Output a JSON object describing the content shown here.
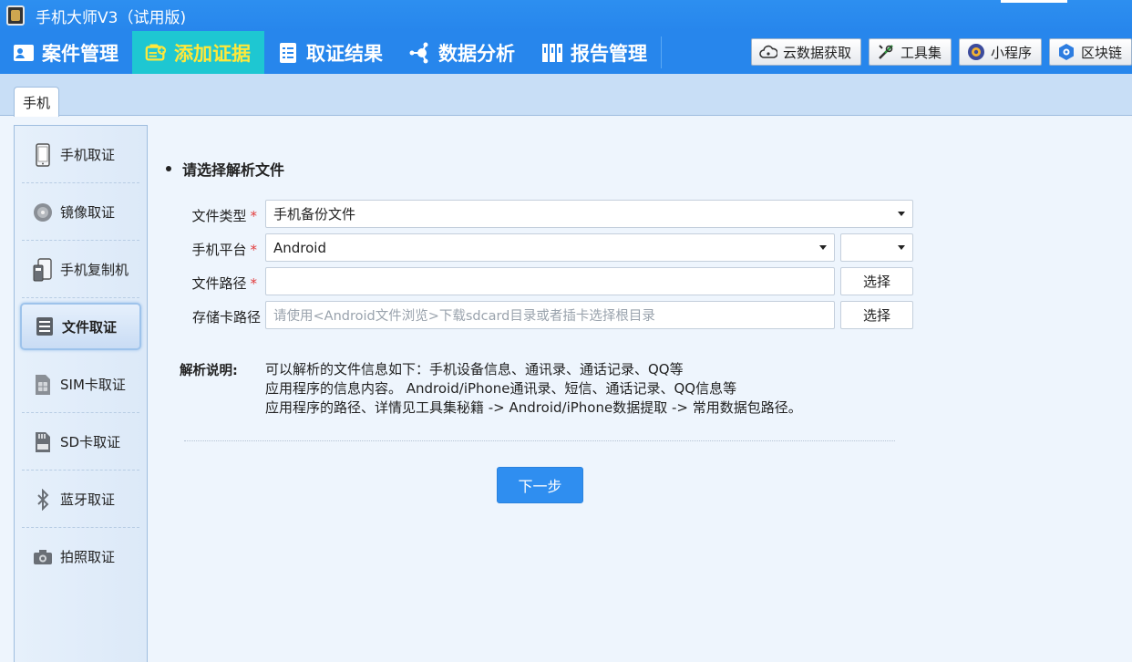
{
  "window": {
    "title": "手机大师V3（试用版)"
  },
  "nav": {
    "items": [
      {
        "label": "案件管理",
        "icon": "user-card-icon"
      },
      {
        "label": "添加证据",
        "icon": "add-evidence-icon",
        "active": true
      },
      {
        "label": "取证结果",
        "icon": "result-list-icon"
      },
      {
        "label": "数据分析",
        "icon": "network-nodes-icon"
      },
      {
        "label": "报告管理",
        "icon": "book-report-icon"
      }
    ],
    "tools": [
      {
        "label": "云数据获取",
        "icon": "cloud-icon"
      },
      {
        "label": "工具集",
        "icon": "wrench-icon"
      },
      {
        "label": "小程序",
        "icon": "mini-program-icon"
      },
      {
        "label": "区块链",
        "icon": "blockchain-icon"
      }
    ]
  },
  "tabs": [
    {
      "label": "手机"
    }
  ],
  "sidebar": {
    "items": [
      {
        "label": "手机取证",
        "icon": "phone-icon"
      },
      {
        "label": "镜像取证",
        "icon": "disc-icon"
      },
      {
        "label": "手机复制机",
        "icon": "phone-copier-icon"
      },
      {
        "label": "文件取证",
        "icon": "file-icon",
        "active": true
      },
      {
        "label": "SIM卡取证",
        "icon": "sim-card-icon"
      },
      {
        "label": "SD卡取证",
        "icon": "sd-card-icon"
      },
      {
        "label": "蓝牙取证",
        "icon": "bluetooth-icon"
      },
      {
        "label": "拍照取证",
        "icon": "camera-icon"
      }
    ]
  },
  "main": {
    "section_title": "请选择解析文件",
    "form": {
      "file_type": {
        "label": "文件类型",
        "value": "手机备份文件"
      },
      "platform": {
        "label": "手机平台",
        "value": "Android",
        "sub_value": ""
      },
      "file_path": {
        "label": "文件路径",
        "value": "",
        "button": "选择"
      },
      "storage_path": {
        "label": "存储卡路径",
        "placeholder": "请使用<Android文件浏览>下载sdcard目录或者插卡选择根目录",
        "button": "选择"
      }
    },
    "description": {
      "label": "解析说明:",
      "lines": [
        "可以解析的文件信息如下：手机设备信息、通讯录、通话记录、QQ等",
        "应用程序的信息内容。 Android/iPhone通讯录、短信、通话记录、QQ信息等",
        "应用程序的路径、详情见工具集秘籍 -> Android/iPhone数据提取 -> 常用数据包路径。"
      ]
    },
    "next_button": "下一步"
  },
  "colors": {
    "nav_bg": "#2786ec",
    "nav_active_bg": "#1ec7d2",
    "nav_active_text": "#ffe83a",
    "required": "#e23c3c",
    "primary_button": "#2f8ef0"
  }
}
